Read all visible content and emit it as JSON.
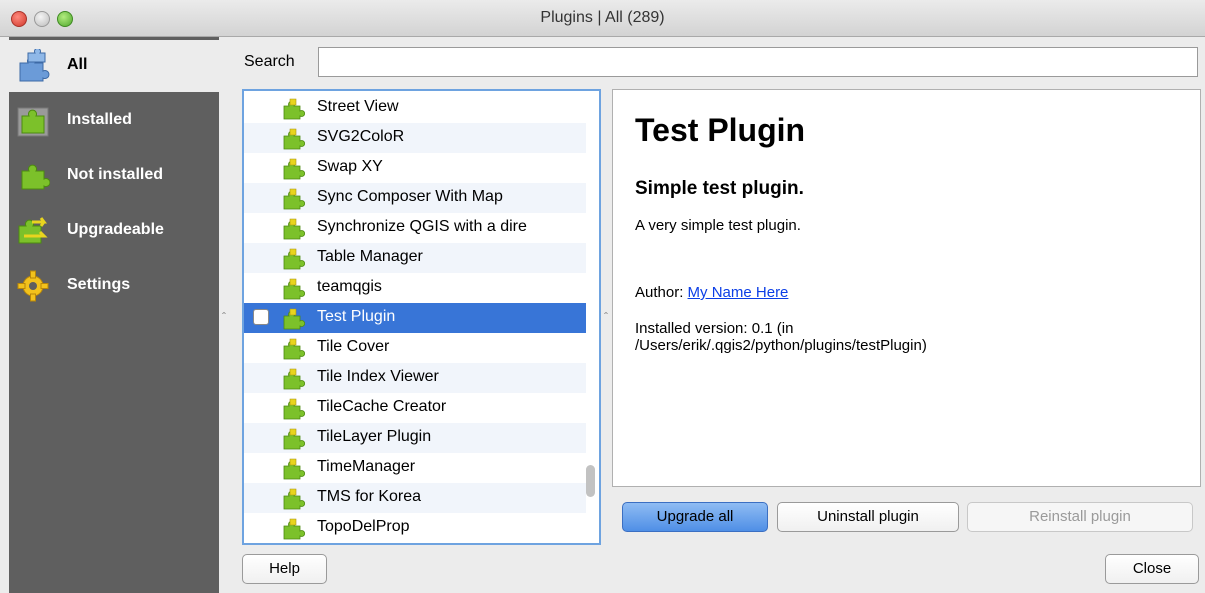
{
  "window": {
    "title": "Plugins | All (289)"
  },
  "sidebar": {
    "items": [
      {
        "label": "All",
        "icon": "puzzle-blue-icon",
        "active": true
      },
      {
        "label": "Installed",
        "icon": "puzzle-installed-icon"
      },
      {
        "label": "Not installed",
        "icon": "puzzle-green-icon"
      },
      {
        "label": "Upgradeable",
        "icon": "puzzle-upgrade-icon"
      },
      {
        "label": "Settings",
        "icon": "gear-icon"
      }
    ]
  },
  "search": {
    "label": "Search",
    "value": "",
    "placeholder": ""
  },
  "plugin_list": {
    "items": [
      "Street View",
      "SVG2ColoR",
      "Swap XY",
      "Sync Composer With Map",
      "Synchronize QGIS with a dire",
      "Table Manager",
      "teamqgis",
      "Test Plugin",
      "Tile Cover",
      "Tile Index Viewer",
      "TileCache Creator",
      "TileLayer Plugin",
      "TimeManager",
      "TMS for Korea",
      "TopoDelProp"
    ],
    "selected": "Test Plugin"
  },
  "detail": {
    "title": "Test Plugin",
    "subtitle": "Simple test plugin.",
    "description": "A very simple test plugin.",
    "author_label": "Author:",
    "author_name": "My Name Here",
    "version_line1": "Installed version: 0.1 (in",
    "version_line2": "/Users/erik/.qgis2/python/plugins/testPlugin)"
  },
  "buttons": {
    "upgrade_all": "Upgrade all",
    "uninstall": "Uninstall plugin",
    "reinstall": "Reinstall plugin",
    "help": "Help",
    "close": "Close"
  },
  "colors": {
    "sidebar_bg": "#5f5f5f",
    "selection": "#3875d7",
    "link": "#0b3ee6",
    "puzzle_green": "#7cc12a",
    "puzzle_yellow": "#e8d41f"
  }
}
